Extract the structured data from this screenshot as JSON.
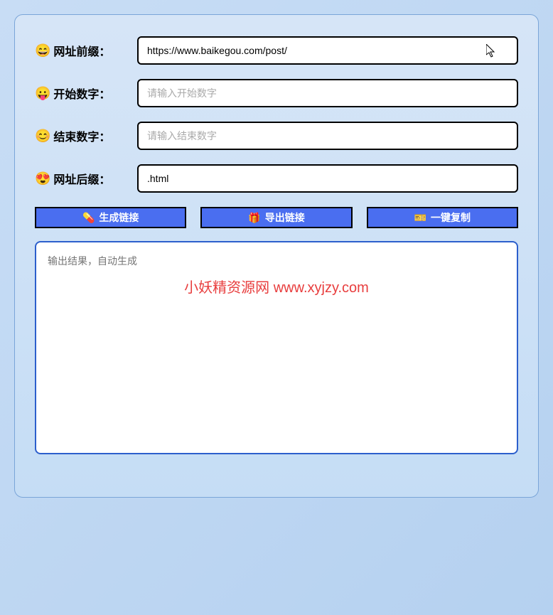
{
  "fields": {
    "prefix": {
      "icon": "😄",
      "label": "网址前缀：",
      "value": "https://www.baikegou.com/post/",
      "placeholder": ""
    },
    "start": {
      "icon": "😛",
      "label": "开始数字：",
      "value": "",
      "placeholder": "请输入开始数字"
    },
    "end": {
      "icon": "😊",
      "label": "结束数字：",
      "value": "",
      "placeholder": "请输入结束数字"
    },
    "suffix": {
      "icon": "😍",
      "label": "网址后缀：",
      "value": ".html",
      "placeholder": ""
    }
  },
  "buttons": {
    "generate": {
      "icon": "💊",
      "label": "生成链接"
    },
    "export": {
      "icon": "🎁",
      "label": "导出链接"
    },
    "copy": {
      "icon": "🎫",
      "label": "一键复制"
    }
  },
  "output": {
    "placeholder": "输出结果，自动生成"
  },
  "watermark": "小妖精资源网 www.xyjzy.com"
}
